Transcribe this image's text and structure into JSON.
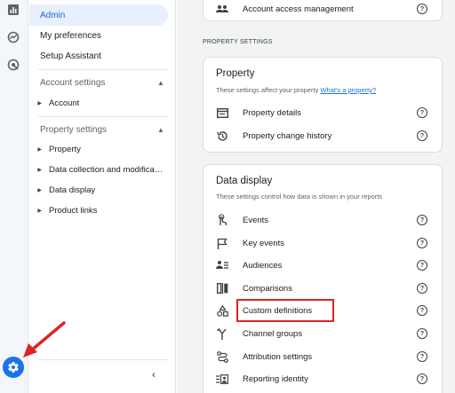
{
  "nav": {
    "admin": "Admin",
    "my_preferences": "My preferences",
    "setup_assistant": "Setup Assistant",
    "account_settings": "Account settings",
    "account": "Account",
    "property_settings": "Property settings",
    "property": "Property",
    "data_collection": "Data collection and modifica…",
    "data_display": "Data display",
    "product_links": "Product links"
  },
  "main": {
    "account_access_management": "Account access management",
    "section_header": "PROPERTY SETTINGS",
    "property_card": {
      "title": "Property",
      "desc": "These settings affect your property",
      "desc_link": "What's a property?",
      "items": [
        "Property details",
        "Property change history"
      ]
    },
    "data_display_card": {
      "title": "Data display",
      "desc": "These settings control how data is shown in your reports",
      "items": [
        "Events",
        "Key events",
        "Audiences",
        "Comparisons",
        "Custom definitions",
        "Channel groups",
        "Attribution settings",
        "Reporting identity"
      ]
    },
    "help_glyph": "?"
  },
  "colors": {
    "accent": "#1a73e8",
    "active_bg": "#e8f0fe",
    "annotation_red": "#e02424"
  },
  "icons": {
    "rail": [
      "reports-icon",
      "explore-icon",
      "advertising-icon",
      "admin-gear-icon"
    ],
    "collapse": "chevron-left-icon"
  }
}
